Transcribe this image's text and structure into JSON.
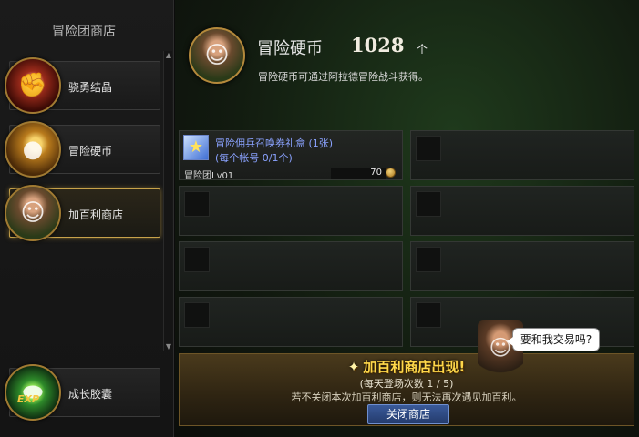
{
  "sidebar": {
    "title": "冒险团商店",
    "items": [
      {
        "label": "骁勇结晶",
        "icon": "fist-icon"
      },
      {
        "label": "冒险硬币",
        "icon": "coin-chest-icon"
      },
      {
        "label": "加百利商店",
        "icon": "merchant-icon"
      },
      {
        "label": "成长胶囊",
        "icon": "exp-capsule-icon"
      }
    ],
    "active_index": 2,
    "exp_tag": "EXP"
  },
  "header": {
    "title": "冒险硬币",
    "count": "1028",
    "unit": "个",
    "description": "冒险硬币可通过阿拉德冒险战斗获得。"
  },
  "shop": {
    "items": [
      {
        "name": "冒险佣兵召唤券礼盒 (1张)",
        "limit": "(每个帐号 0/1个)",
        "requirement": "冒险团Lv01",
        "price": "70",
        "icon": "star-ticket-icon"
      }
    ],
    "empty_slots": 9
  },
  "banner": {
    "title": "加百利商店出现!",
    "visit_count": "(每天登场次数 1 / 5)",
    "warning": "若不关闭本次加百利商店，则无法再次遇见加百利。",
    "close_label": "关闭商店"
  },
  "merchant": {
    "speech": "要和我交易吗?"
  },
  "colors": {
    "accent_gold": "#c7a24a",
    "item_name_blue": "#8aa2ff",
    "banner_title": "#ffd84a",
    "button_blue": "#2f4b86"
  }
}
